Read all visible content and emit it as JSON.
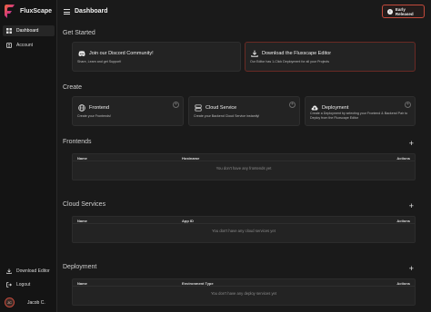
{
  "app": {
    "name": "FluxScape"
  },
  "sidebar": {
    "items": [
      {
        "label": "Dashboard",
        "icon": "dashboard-icon",
        "active": true
      },
      {
        "label": "Account",
        "icon": "account-icon",
        "active": false
      }
    ],
    "bottom": [
      {
        "label": "Download Editor",
        "icon": "download-icon"
      },
      {
        "label": "Logout",
        "icon": "logout-icon"
      }
    ],
    "user": {
      "initials": "JC",
      "name": "Jacob C."
    }
  },
  "header": {
    "title": "Dashboard",
    "badge": "Early Released"
  },
  "get_started": {
    "heading": "Get Started",
    "cards": [
      {
        "title": "Join our Discord Community!",
        "desc": "Share, Learn and get Support!",
        "icon": "discord-icon"
      },
      {
        "title": "Download the Fluxscape Editor",
        "desc": "Our Editor has 1-Click Deployment for all your Projects",
        "icon": "download-icon"
      }
    ]
  },
  "create": {
    "heading": "Create",
    "cards": [
      {
        "title": "Frontend",
        "desc": "Create your Frontends!",
        "icon": "globe-icon"
      },
      {
        "title": "Cloud Service",
        "desc": "Create your Backend Cloud Service instantly!",
        "icon": "server-icon"
      },
      {
        "title": "Deployment",
        "desc": "Create a Deployment by selecting your Frontend & Backend Pair to Deploy from the Fluxscape Editor",
        "icon": "cloud-upload-icon"
      }
    ]
  },
  "frontends": {
    "heading": "Frontends",
    "columns": [
      "Name",
      "Hostname",
      "Actions"
    ],
    "empty": "You don't have any frontends yet"
  },
  "cloud_services": {
    "heading": "Cloud Services",
    "columns": [
      "Name",
      "App ID",
      "Actions"
    ],
    "empty": "You don't have any cloud services yet"
  },
  "deployment": {
    "heading": "Deployment",
    "columns": [
      "Name",
      "Environment Type",
      "Actions"
    ],
    "empty": "You don't have any deploy services yet"
  },
  "colors": {
    "accent": "#c44a3c",
    "background": "#1a1a1a",
    "card": "#232323"
  }
}
